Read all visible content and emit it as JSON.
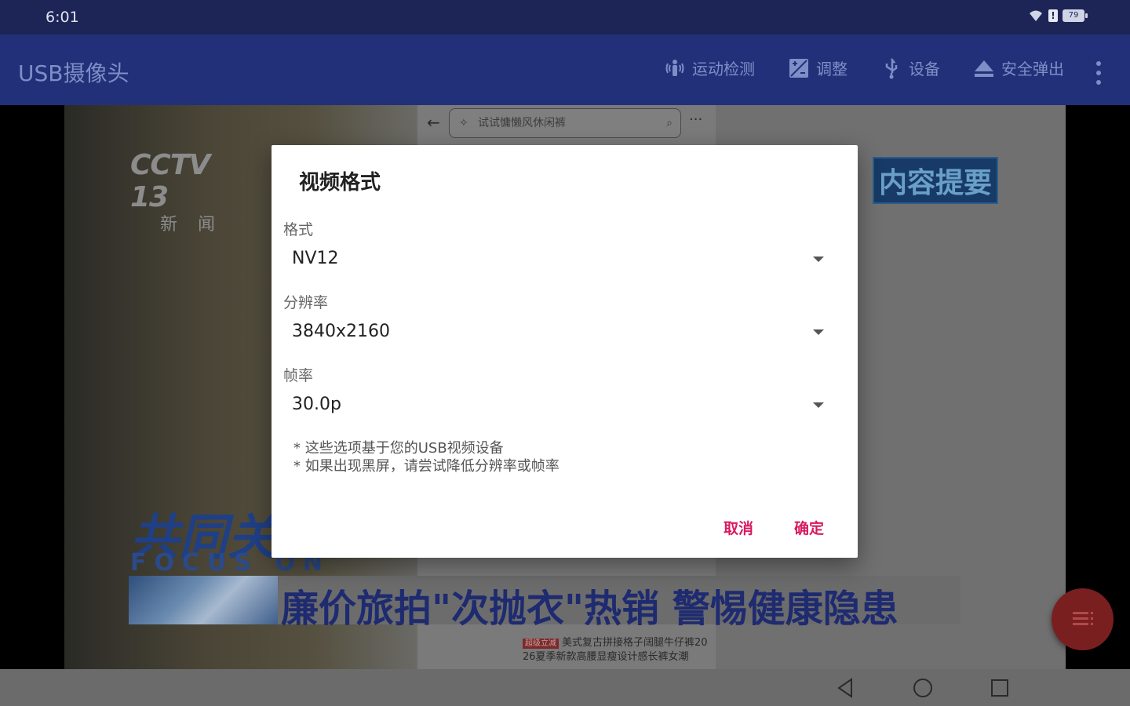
{
  "status": {
    "time": "6:01",
    "battery": "79"
  },
  "app_bar": {
    "title": "USB摄像头",
    "actions": [
      {
        "label": "运动检测",
        "icon": "motion-detect-icon"
      },
      {
        "label": "调整",
        "icon": "exposure-adjust-icon"
      },
      {
        "label": "设备",
        "icon": "usb-icon"
      },
      {
        "label": "安全弹出",
        "icon": "eject-icon"
      }
    ]
  },
  "preview": {
    "search_placeholder": "试试慵懒风休闲裤",
    "channel_logo": "CCTV 13",
    "channel_sub": "新闻",
    "badge": "内容提要",
    "focus_cn": "共同关",
    "focus_en": "FOCUS ON",
    "headline": "廉价旅拍\"次抛衣\"热销 警惕健康隐患",
    "shop_tag": "超级立减",
    "shop_line1": "美式复古拼接格子阔腿牛仔裤20",
    "shop_line2": "26夏季新款高腰显瘦设计感长裤女潮"
  },
  "dialog": {
    "title": "视频格式",
    "fields": [
      {
        "label": "格式",
        "value": "NV12"
      },
      {
        "label": "分辨率",
        "value": "3840x2160"
      },
      {
        "label": "帧率",
        "value": "30.0p"
      }
    ],
    "notes": [
      "* 这些选项基于您的USB视频设备",
      "* 如果出现黑屏，请尝试降低分辨率或帧率"
    ],
    "cancel": "取消",
    "confirm": "确定"
  }
}
